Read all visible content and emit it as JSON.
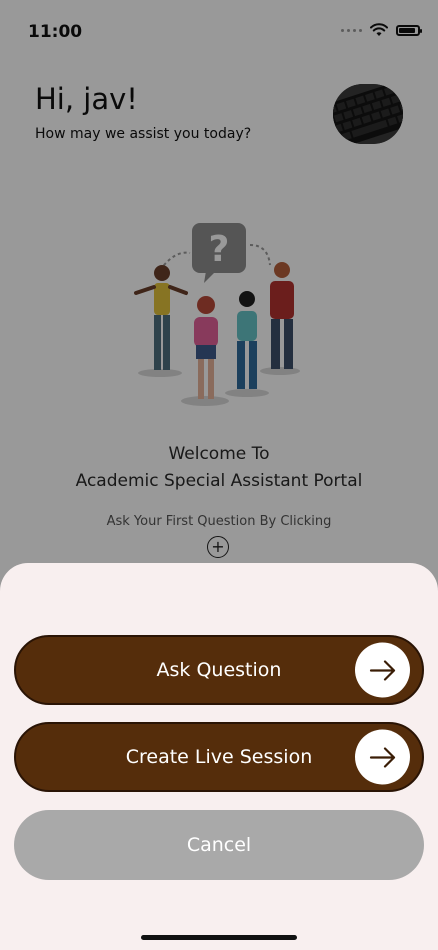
{
  "status_bar": {
    "time": "11:00",
    "icons": [
      "signal-dots-icon",
      "wifi-icon",
      "battery-icon"
    ]
  },
  "header": {
    "greeting": "Hi, jav!",
    "subtitle": "How may we assist you today?",
    "avatar": "keyboard-avatar"
  },
  "main": {
    "illustration": "people-question-illustration",
    "welcome_line1": "Welcome To",
    "welcome_line2": "Academic Special Assistant Portal",
    "ask_hint": "Ask Your First Question By Clicking",
    "plus_symbol": "+"
  },
  "sheet": {
    "ask_question_label": "Ask Question",
    "create_live_session_label": "Create Live Session",
    "cancel_label": "Cancel",
    "arrow_icon": "arrow-right-icon"
  },
  "colors": {
    "primary_button": "#552d0b",
    "cancel_button": "#a9a9a9",
    "sheet_background": "#f8efef",
    "overlay": "rgba(0,0,0,0.40)"
  }
}
